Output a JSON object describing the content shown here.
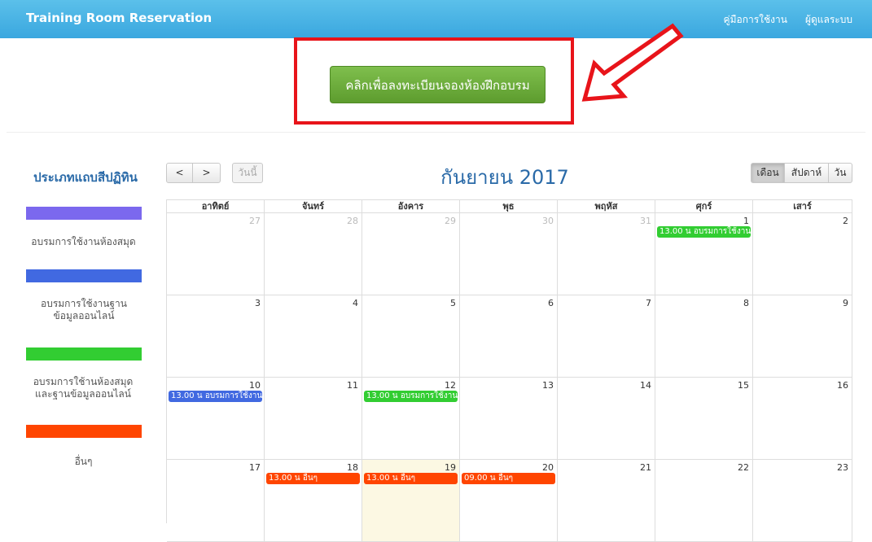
{
  "navbar": {
    "brand": "Training Room Reservation",
    "links": [
      "คู่มือการใช้งาน",
      "ผู้ดูแลระบบ"
    ]
  },
  "cta": {
    "label": "คลิกเพื่อลงทะเบียนจองห้องฝึกอบรม"
  },
  "legend": {
    "title": "ประเภทแถบสีปฏิทิน",
    "items": [
      {
        "label": "อบรมการใช้งานห้องสมุด",
        "color": "#7b68ee"
      },
      {
        "label": "อบรมการใช้งานฐานข้อมูลออนไลน์",
        "color": "#4169e1"
      },
      {
        "label": "อบรมการใช้านห้องสมุดและฐานข้อมูลออนไลน์",
        "color": "#32cd32"
      },
      {
        "label": "อื่นๆ",
        "color": "#ff4500"
      }
    ]
  },
  "toolbar": {
    "prev": "<",
    "next": ">",
    "today": "วันนี้",
    "title": "กันยายน 2017",
    "views": [
      {
        "label": "เดือน",
        "active": true
      },
      {
        "label": "สัปดาห์",
        "active": false
      },
      {
        "label": "วัน",
        "active": false
      }
    ]
  },
  "calendar": {
    "weekdays": [
      "อาทิตย์",
      "จันทร์",
      "อังคาร",
      "พุธ",
      "พฤหัส",
      "ศุกร์",
      "เสาร์"
    ],
    "weeks": [
      [
        {
          "n": "27",
          "other": true
        },
        {
          "n": "28",
          "other": true
        },
        {
          "n": "29",
          "other": true
        },
        {
          "n": "30",
          "other": true
        },
        {
          "n": "31",
          "other": true
        },
        {
          "n": "1",
          "event": {
            "text": "13.00 น อบรมการใช้งานห้",
            "color": "#32cd32"
          }
        },
        {
          "n": "2"
        }
      ],
      [
        {
          "n": "3"
        },
        {
          "n": "4"
        },
        {
          "n": "5"
        },
        {
          "n": "6"
        },
        {
          "n": "7"
        },
        {
          "n": "8"
        },
        {
          "n": "9"
        }
      ],
      [
        {
          "n": "10",
          "event": {
            "text": "13.00 น อบรมการใช้งานฐ",
            "color": "#4169e1"
          }
        },
        {
          "n": "11"
        },
        {
          "n": "12",
          "event": {
            "text": "13.00 น อบรมการใช้งานห้",
            "color": "#32cd32"
          }
        },
        {
          "n": "13"
        },
        {
          "n": "14"
        },
        {
          "n": "15"
        },
        {
          "n": "16"
        }
      ],
      [
        {
          "n": "17"
        },
        {
          "n": "18",
          "event": {
            "text": "13.00 น อื่นๆ",
            "color": "#ff4500"
          }
        },
        {
          "n": "19",
          "today": true,
          "event": {
            "text": "13.00 น อื่นๆ",
            "color": "#ff4500"
          }
        },
        {
          "n": "20",
          "event": {
            "text": "09.00 น อื่นๆ",
            "color": "#ff4500"
          }
        },
        {
          "n": "21"
        },
        {
          "n": "22"
        },
        {
          "n": "23"
        }
      ]
    ]
  }
}
